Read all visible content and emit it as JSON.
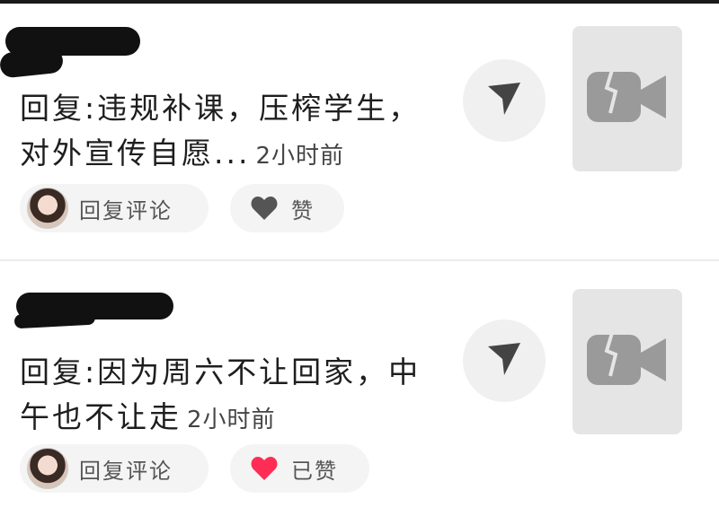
{
  "notifications": [
    {
      "comment_prefix": "回复:",
      "comment_body": "违规补课，压榨学生，对外宣传自愿...",
      "time": "2小时前",
      "reply_label": "回复评论",
      "like_label": "赞",
      "liked": false,
      "heart_color": "#555555",
      "icons": {
        "avatar": "avatar-image",
        "like": "heart-icon",
        "send": "send-arrow-icon",
        "media": "video-camera-icon"
      }
    },
    {
      "comment_prefix": "回复:",
      "comment_body": "因为周六不让回家，中午也不让走",
      "time": "2小时前",
      "reply_label": "回复评论",
      "like_label": "已赞",
      "liked": true,
      "heart_color": "#ff2d55",
      "icons": {
        "avatar": "avatar-image",
        "like": "heart-icon",
        "send": "send-arrow-icon",
        "media": "video-camera-icon"
      }
    }
  ],
  "colors": {
    "pill_bg": "#f4f4f4",
    "thumb_bg": "#e5e5e5",
    "icon_gray": "#555555",
    "liked_red": "#ff2d55"
  }
}
